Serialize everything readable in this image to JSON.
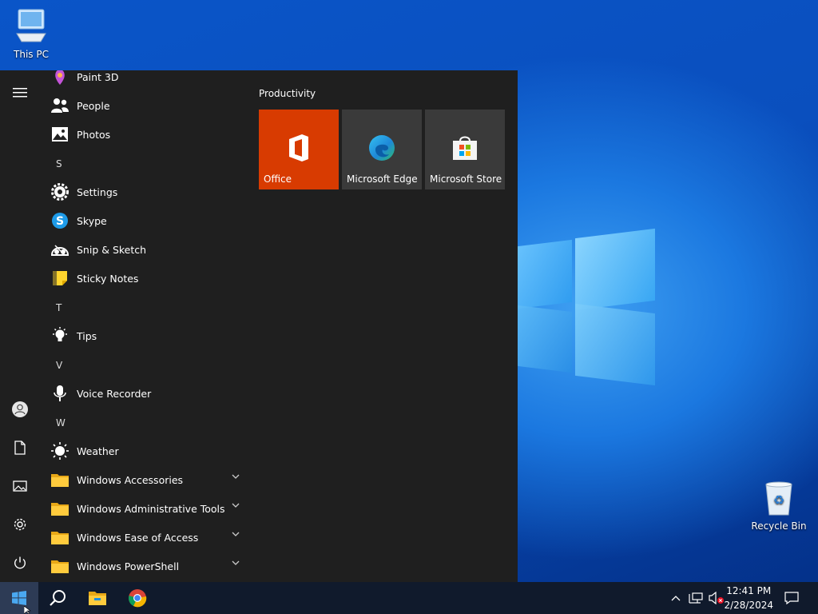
{
  "desktop": {
    "this_pc": "This PC",
    "recycle_bin": "Recycle Bin"
  },
  "start_menu": {
    "apps": [
      {
        "label": "Paint 3D",
        "icon": "paint-3d-icon"
      },
      {
        "label": "People",
        "icon": "people-icon"
      },
      {
        "label": "Photos",
        "icon": "photos-icon"
      },
      {
        "label": "Settings",
        "icon": "gear-icon"
      },
      {
        "label": "Skype",
        "icon": "skype-icon"
      },
      {
        "label": "Snip & Sketch",
        "icon": "snip-sketch-icon"
      },
      {
        "label": "Sticky Notes",
        "icon": "sticky-notes-icon"
      },
      {
        "label": "Tips",
        "icon": "lightbulb-icon"
      },
      {
        "label": "Voice Recorder",
        "icon": "microphone-icon"
      },
      {
        "label": "Weather",
        "icon": "sun-icon"
      },
      {
        "label": "Windows Accessories",
        "icon": "folder-icon"
      },
      {
        "label": "Windows Administrative Tools",
        "icon": "folder-icon"
      },
      {
        "label": "Windows Ease of Access",
        "icon": "folder-icon"
      },
      {
        "label": "Windows PowerShell",
        "icon": "folder-icon"
      }
    ],
    "letters": {
      "s": "S",
      "t": "T",
      "v": "V",
      "w": "W"
    },
    "tile_group": "Productivity",
    "tiles": [
      {
        "label": "Office",
        "color": "#d83b01"
      },
      {
        "label": "Microsoft Edge",
        "color": "#3a3a3a"
      },
      {
        "label": "Microsoft Store",
        "color": "#3a3a3a"
      }
    ]
  },
  "taskbar": {
    "time": "12:41 PM",
    "date": "2/28/2024"
  },
  "colors": {
    "start_bg": "#1f1f1f",
    "accent_office": "#d83b01",
    "taskbar": "#101a2c"
  }
}
